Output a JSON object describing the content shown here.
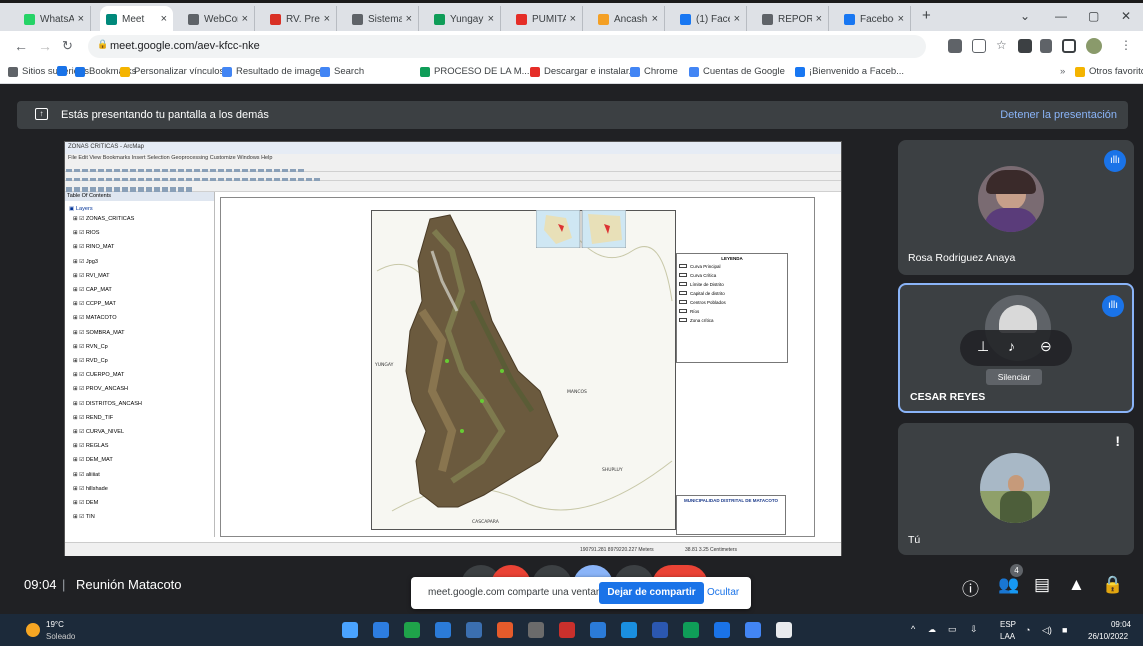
{
  "browser": {
    "tabs": [
      {
        "label": "WhatsAp",
        "color": "#25d366"
      },
      {
        "label": "Meet",
        "color": "#00897b",
        "active": true
      },
      {
        "label": "WebCom",
        "color": "#5f6368"
      },
      {
        "label": "RV. Precu",
        "color": "#d93025"
      },
      {
        "label": "Sistema",
        "color": "#5f6368"
      },
      {
        "label": "Yungay -",
        "color": "#0f9d58"
      },
      {
        "label": "PUMITA",
        "color": "#e52d27"
      },
      {
        "label": "Ancash",
        "color": "#f4a025"
      },
      {
        "label": "(1) Faceb",
        "color": "#1877f2"
      },
      {
        "label": "REPORT",
        "color": "#5f6368"
      },
      {
        "label": "Facebook",
        "color": "#1877f2"
      }
    ],
    "new_tab": "+",
    "address": "meet.google.com/aev-kfcc-nke",
    "bookmarks": [
      {
        "label": "Sitios sugeridos",
        "color": "#5f6368"
      },
      {
        "label": "",
        "color": "#1a73e8"
      },
      {
        "label": "Bookmarks",
        "color": "#1a73e8"
      },
      {
        "label": "Personalizar vínculos",
        "color": "#f4b400"
      },
      {
        "label": "Resultado de image...",
        "color": "#4285f4"
      },
      {
        "label": "Search",
        "color": "#4285f4"
      },
      {
        "label": "PROCESO DE LA M...",
        "color": "#0f9d58"
      },
      {
        "label": "Descargar e instalar...",
        "color": "#e52d27"
      },
      {
        "label": "Chrome",
        "color": "#4285f4"
      },
      {
        "label": "Cuentas de Google",
        "color": "#4285f4"
      },
      {
        "label": "¡Bienvenido a Faceb...",
        "color": "#1877f2"
      }
    ],
    "other_favorites": "Otros favoritos"
  },
  "banner": {
    "text": "Estás presentando tu pantalla a los demás",
    "stop_link": "Detener la presentación"
  },
  "arcmap": {
    "title": "ZONAS CRITICAS - ArcMap",
    "menu": "File  Edit  View  Bookmarks  Insert  Selection  Geoprocessing  Customize  Windows  Help",
    "toc_header": "Table Of Contents",
    "layers_label": "Layers",
    "layers": [
      "ZONAS_CRITICAS",
      "RIOS",
      "RINO_MAT",
      "Jpg3",
      "RVI_MAT",
      "CAP_MAT",
      "CCPP_MAT",
      "MATACOTO",
      "SOMBRA_MAT",
      "RVN_Cp",
      "RVD_Cp",
      "CUERPO_MAT",
      "PROV_ANCASH",
      "DISTRITOS_ANCASH",
      "REND_TIF",
      "CURVA_NIVEL",
      "REGLAS",
      "DEM_MAT",
      "aliiiiat",
      "hillshade",
      "DEM",
      "TIN"
    ],
    "legend_title": "LEYENDA",
    "legend_items": [
      "Curva Principal",
      "Curva Crítica",
      "Límite de Distrito",
      "Capital de distrito",
      "Centros Poblados",
      "Ríos",
      "Zona crítica"
    ],
    "title_block": "MUNICIPALIDAD DISTRITAL DE MATACOTO",
    "status": "190791.281  8979220.227 Meters",
    "status2": "38.81  3.25 Centimeters",
    "map_labels": [
      "YUNGAY",
      "MANCOS",
      "SHUPLUY",
      "CASCAPARA"
    ]
  },
  "participants": [
    {
      "name": "Rosa Rodriguez Anaya"
    },
    {
      "name": "CESAR REYES"
    },
    {
      "name": "Tú"
    }
  ],
  "tooltip": "Silenciar",
  "meeting": {
    "time": "09:04",
    "separator": "|",
    "name": "Reunión Matacoto",
    "participant_count": "4"
  },
  "share_bar": {
    "message": "meet.google.com comparte una ventana.",
    "stop_button": "Dejar de compartir",
    "hide_button": "Ocultar"
  },
  "taskbar": {
    "weather_temp": "19°C",
    "weather_desc": "Soleado",
    "lang": "ESP",
    "lang2": "LAA",
    "clock_time": "09:04",
    "clock_date": "26/10/2022"
  }
}
